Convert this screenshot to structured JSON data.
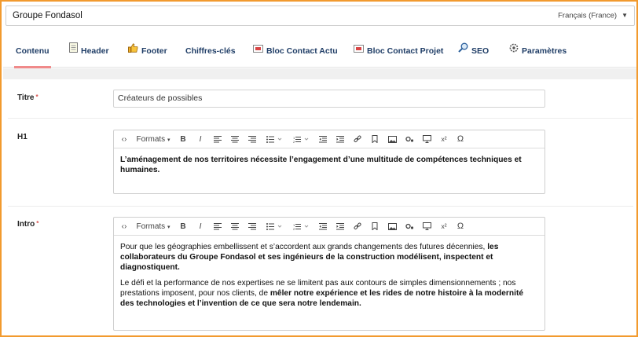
{
  "header": {
    "name_value": "Groupe Fondasol",
    "language": "Français (France)"
  },
  "tabs": [
    {
      "label": "Contenu",
      "icon": "none",
      "active": true
    },
    {
      "label": "Header",
      "icon": "document-icon"
    },
    {
      "label": "Footer",
      "icon": "thumbs-up-icon"
    },
    {
      "label": "Chiffres-clés",
      "icon": "none"
    },
    {
      "label": "Bloc Contact Actu",
      "icon": "envelope-icon"
    },
    {
      "label": "Bloc Contact Projet",
      "icon": "envelope-icon"
    },
    {
      "label": "SEO",
      "icon": "magnifier-icon"
    },
    {
      "label": "Paramètres",
      "icon": "gear-icon"
    }
  ],
  "colors": {
    "tab_text": "#1f3d66",
    "active_underline": "#f08a8a",
    "required_marker": "#d9534f",
    "frame_border": "#f29a2e"
  },
  "fields": {
    "titre": {
      "label": "Titre",
      "required_mark": "*",
      "value": "Créateurs de possibles"
    },
    "h1": {
      "label": "H1",
      "content": "L’aménagement de nos territoires nécessite l’engagement d’une multitude de compétences techniques et humaines."
    },
    "intro": {
      "label": "Intro",
      "required_mark": "*",
      "p1_normal": "Pour que les géographies embellissent et s’accordent aux grands changements des futures décennies, ",
      "p1_bold": "les collaborateurs du Groupe Fondasol et ses ingénieurs de la construction modélisent, inspectent et diagnostiquent.",
      "p2_normal": "Le défi et la performance de nos expertises ne se limitent pas aux contours de simples dimensionnements ; nos prestations imposent, pour nos clients, de ",
      "p2_bold": "mêler notre expérience et les rides de notre histoire à la modernité des technologies et l’invention de ce que sera notre lendemain."
    }
  },
  "toolbar": {
    "formats_label": "Formats",
    "bold": "B",
    "italic": "I",
    "superscript": "x²",
    "omega": "Ω",
    "source_code": "‹›"
  }
}
